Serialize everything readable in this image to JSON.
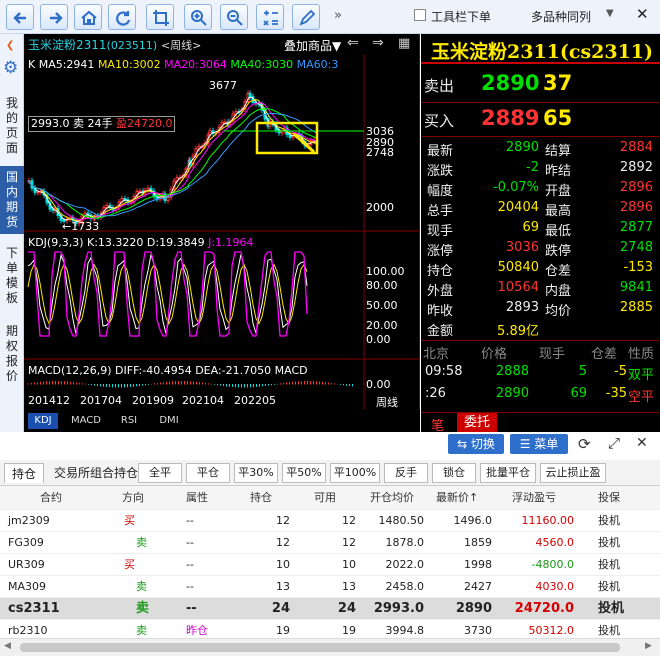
{
  "toolbar": {
    "more": "»",
    "toolbar_order_label": "工具栏下单",
    "multi_variety_label": "多品种同列"
  },
  "sidebar": [
    {
      "label": "我的页面",
      "active": false
    },
    {
      "label": "国内期货",
      "active": true
    },
    {
      "label": "下单模板",
      "active": false
    },
    {
      "label": "期权报价",
      "active": false
    }
  ],
  "chart": {
    "title_name": "玉米淀粉2311",
    "title_code": "(023511)",
    "title_period": "<周线>",
    "overlay_label": "叠加商品",
    "ma_labels": {
      "ma5": "K MA5:2941",
      "ma10": "MA10:3002",
      "ma20": "MA20:3064",
      "ma40": "MA40:3030",
      "ma60": "MA60:3"
    },
    "position_label": "2993.0  卖  24手",
    "position_profit": "盈24720.0",
    "high_label": "3677",
    "low_label": "1733",
    "price_right_labels": [
      "3036",
      "2890",
      "2748",
      "2000"
    ],
    "kdj_label": "KDJ(9,3,3)  K:13.3220  D:19.3849",
    "kdj_j": "J:1.1964",
    "kdj_axis": [
      "100.00",
      "80.00",
      "50.00",
      "20.00",
      "0.00"
    ],
    "macd_label": "MACD(12,26,9)  DIFF:-40.4954  DEA:-21.7050  MACD",
    "macd_axis": "0.00",
    "x_dates": [
      "201412",
      "201704",
      "201909",
      "202104",
      "202205"
    ],
    "period_label": "周线",
    "indicator_tabs": [
      "KDJ",
      "MACD",
      "RSI",
      "DMI"
    ],
    "colors": {
      "up": "#ff3333",
      "down": "#00e0e0",
      "ma5": "#ffffff",
      "ma10": "#ffea00",
      "ma20": "#ff00ff",
      "ma40": "#00ff00",
      "ma60": "#3399ff"
    },
    "chart_data": {
      "type": "line",
      "title": "玉米淀粉2311(023511)<周线>",
      "x_ticks": [
        "201412",
        "201704",
        "201909",
        "202104",
        "202205"
      ],
      "price_high": 3677,
      "price_low": 1733,
      "current_price": 2890,
      "kdj": {
        "K": 13.322,
        "D": 19.3849,
        "J": 1.1964,
        "ylim": [
          0,
          100
        ]
      },
      "macd": {
        "DIFF": -40.4954,
        "DEA": -21.705
      }
    }
  },
  "quote": {
    "title": "玉米淀粉2311(cs2311)",
    "sell_label": "卖出",
    "sell_price": "2890",
    "sell_vol": "37",
    "buy_label": "买入",
    "buy_price": "2889",
    "buy_vol": "65",
    "rows": [
      {
        "l1": "最新",
        "v1": "2890",
        "c1": "grn",
        "l2": "结算",
        "v2": "2884",
        "c2": "red"
      },
      {
        "l1": "涨跌",
        "v1": "-2",
        "c1": "grn",
        "l2": "昨结",
        "v2": "2892",
        "c2": "wht"
      },
      {
        "l1": "幅度",
        "v1": "-0.07%",
        "c1": "grn",
        "l2": "开盘",
        "v2": "2896",
        "c2": "red"
      },
      {
        "l1": "总手",
        "v1": "20404",
        "c1": "yel",
        "l2": "最高",
        "v2": "2896",
        "c2": "red"
      },
      {
        "l1": "现手",
        "v1": "69",
        "c1": "yel",
        "l2": "最低",
        "v2": "2877",
        "c2": "grn"
      },
      {
        "l1": "涨停",
        "v1": "3036",
        "c1": "red",
        "l2": "跌停",
        "v2": "2748",
        "c2": "grn"
      },
      {
        "l1": "持仓",
        "v1": "50840",
        "c1": "yel",
        "l2": "仓差",
        "v2": "-153",
        "c2": "yel"
      },
      {
        "l1": "外盘",
        "v1": "10564",
        "c1": "red",
        "l2": "内盘",
        "v2": "9841",
        "c2": "grn"
      },
      {
        "l1": "昨收",
        "v1": "2893",
        "c1": "wht",
        "l2": "均价",
        "v2": "2885",
        "c2": "yel"
      },
      {
        "l1": "金额",
        "v1": "5.89亿",
        "c1": "yel",
        "l2": "",
        "v2": "",
        "c2": "wht"
      }
    ],
    "tick_header": [
      "北京",
      "价格",
      "现手",
      "仓差",
      "性质"
    ],
    "ticks": [
      {
        "time": "09:58",
        "price": "2888",
        "vol": "5",
        "diff": "-5",
        "nature": "双平"
      },
      {
        "time": ":26",
        "price": "2890",
        "vol": "69",
        "diff": "-35",
        "nature": "空平"
      }
    ],
    "tab_bi": "笔",
    "tab_weituo": "委托"
  },
  "actions": {
    "switch": "⇆ 切换",
    "menu": "☰ 菜单"
  },
  "position_tabs": [
    "持仓",
    "交易所组合持仓"
  ],
  "action_buttons": [
    "全平",
    "平仓",
    "平30%",
    "平50%",
    "平100%",
    "反手",
    "锁仓",
    "批量平仓",
    "云止损止盈"
  ],
  "table": {
    "headers": [
      "合约",
      "方向",
      "属性",
      "持仓",
      "可用",
      "开仓均价",
      "最新价↑",
      "浮动盈亏",
      "投保"
    ],
    "rows": [
      {
        "contract": "jm2309",
        "dir": "买",
        "dir_color": "red",
        "attr": "--",
        "pos": "12",
        "avail": "12",
        "open": "1480.50",
        "last": "1496.0",
        "pnl": "11160.00",
        "pnl_color": "red",
        "type": "投机",
        "sel": false
      },
      {
        "contract": "FG309",
        "dir": "卖",
        "dir_color": "grn",
        "attr": "--",
        "pos": "12",
        "avail": "12",
        "open": "1878.0",
        "last": "1859",
        "pnl": "4560.0",
        "pnl_color": "red",
        "type": "投机",
        "sel": false
      },
      {
        "contract": "UR309",
        "dir": "买",
        "dir_color": "red",
        "attr": "--",
        "pos": "10",
        "avail": "10",
        "open": "2022.0",
        "last": "1998",
        "pnl": "-4800.0",
        "pnl_color": "grn",
        "type": "投机",
        "sel": false
      },
      {
        "contract": "MA309",
        "dir": "卖",
        "dir_color": "grn",
        "attr": "--",
        "pos": "13",
        "avail": "13",
        "open": "2458.0",
        "last": "2427",
        "pnl": "4030.0",
        "pnl_color": "red",
        "type": "投机",
        "sel": false
      },
      {
        "contract": "cs2311",
        "dir": "卖",
        "dir_color": "grn",
        "attr": "--",
        "pos": "24",
        "avail": "24",
        "open": "2993.0",
        "last": "2890",
        "pnl": "24720.0",
        "pnl_color": "red",
        "type": "投机",
        "sel": true
      },
      {
        "contract": "rb2310",
        "dir": "卖",
        "dir_color": "grn",
        "attr": "昨仓",
        "attr_color": "mag",
        "pos": "19",
        "avail": "19",
        "open": "3994.8",
        "last": "3730",
        "pnl": "50312.0",
        "pnl_color": "red",
        "type": "投机",
        "sel": false
      }
    ]
  }
}
